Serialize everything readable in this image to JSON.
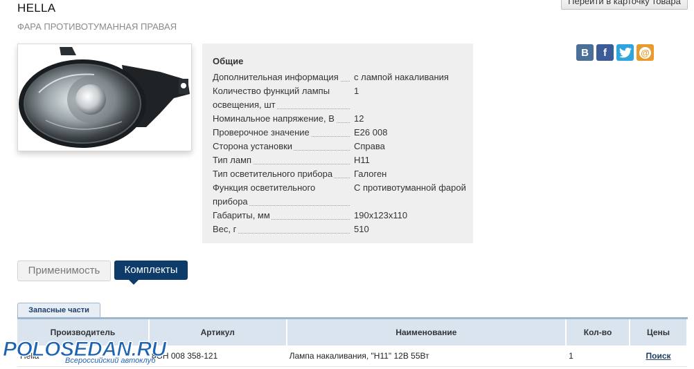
{
  "header": {
    "brand": "HELLA",
    "subtitle": "ФАРА ПРОТИВОТУМАННАЯ ПРАВАЯ",
    "goto_card_button": "Перейти в карточку товара"
  },
  "specs": {
    "heading": "Общие",
    "rows": [
      {
        "name": "Дополнительная информация",
        "value": "с лампой накаливания"
      },
      {
        "name": "Количество функций лампы освещения, шт",
        "value": "1"
      },
      {
        "name": "Номинальное напряжение, В",
        "value": "12"
      },
      {
        "name": "Проверочное значение",
        "value": "E26 008"
      },
      {
        "name": "Сторона установки",
        "value": "Справа"
      },
      {
        "name": "Тип ламп",
        "value": "H11"
      },
      {
        "name": "Тип осветительного прибора",
        "value": "Галоген"
      },
      {
        "name": "Функция осветительного прибора",
        "value": "С противотуманной фарой"
      },
      {
        "name": "Габариты, мм",
        "value": "190x123x110"
      },
      {
        "name": "Вес, г",
        "value": "510"
      }
    ]
  },
  "social": {
    "vk": "В",
    "fb": "f",
    "tw": "t",
    "mail": "@"
  },
  "tabs": {
    "applicability": "Применимость",
    "kits": "Комплекты"
  },
  "parts": {
    "subtab": "Запасные части",
    "headers": [
      "Производитель",
      "Артикул",
      "Наименование",
      "Кол-во",
      "Цены"
    ],
    "rows": [
      {
        "maker": "Hella",
        "article": "8GH 008 358-121",
        "name": "Лампа накаливания, \"H11\" 12В 55Вт",
        "qty": "1",
        "price_link": "Поиск"
      }
    ]
  },
  "watermark": {
    "title": "POLOSEDAN.RU",
    "subtitle": "Всероссийский автоклуб"
  }
}
